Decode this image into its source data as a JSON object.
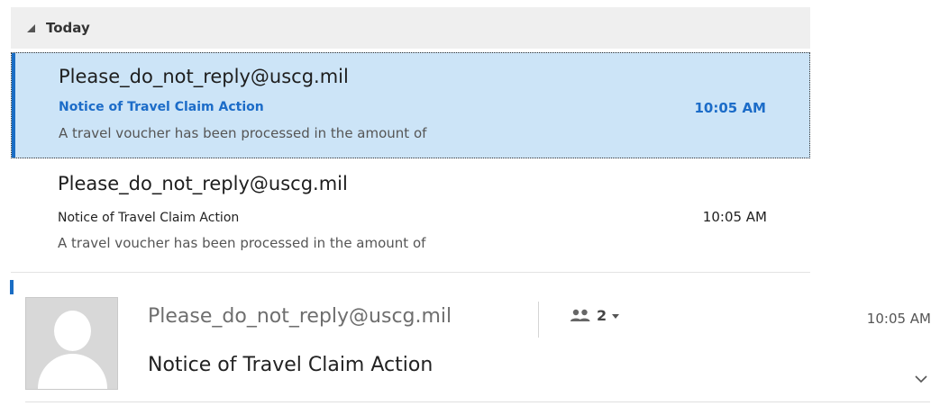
{
  "group": {
    "label": "Today"
  },
  "messages": [
    {
      "sender": "Please_do_not_reply@uscg.mil",
      "subject": "Notice of Travel Claim Action",
      "time": "10:05 AM",
      "preview": "A travel voucher has been processed in the amount of",
      "selected": true
    },
    {
      "sender": "Please_do_not_reply@uscg.mil",
      "subject": "Notice of Travel Claim Action",
      "time": "10:05 AM",
      "preview": "A travel voucher has been processed in the amount of",
      "selected": false
    }
  ],
  "reading_pane": {
    "sender": "Please_do_not_reply@uscg.mil",
    "recipient_count": "2",
    "time": "10:05 AM",
    "subject": "Notice of Travel Claim Action",
    "icons": {
      "avatar": "default-avatar-icon",
      "recipients": "people-icon",
      "expand": "chevron-down-icon"
    }
  },
  "colors": {
    "accent": "#1a6dc4",
    "selected_background": "#cce4f7",
    "selected_text": "#1c6cc8",
    "group_header_background": "#efefef"
  }
}
